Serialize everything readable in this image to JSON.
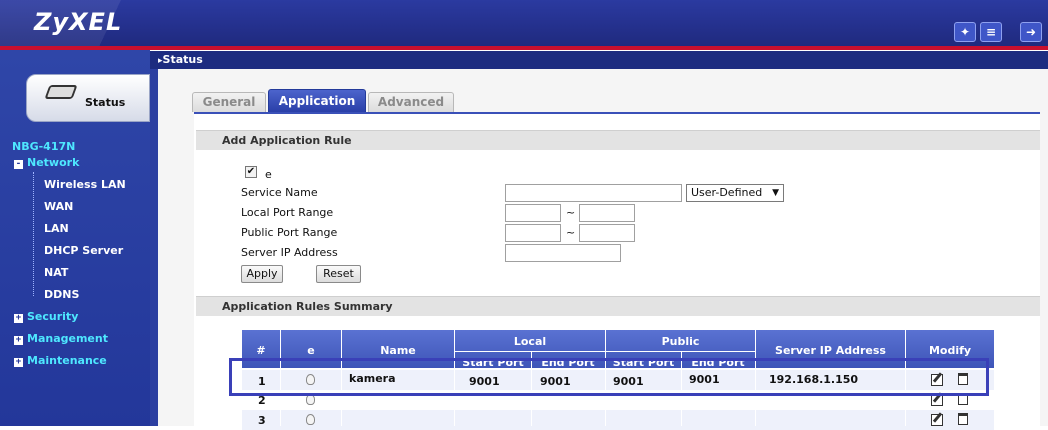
{
  "header": {
    "brand": "ZyXEL"
  },
  "page_title": "Status",
  "status_tab_label": "Status",
  "nav": {
    "device": "NBG-417N",
    "items": [
      {
        "label": "Network",
        "level": "top",
        "expander": "-"
      },
      {
        "label": "Wireless LAN",
        "level": "sub"
      },
      {
        "label": "WAN",
        "level": "sub"
      },
      {
        "label": "LAN",
        "level": "sub"
      },
      {
        "label": "DHCP Server",
        "level": "sub"
      },
      {
        "label": "NAT",
        "level": "sub"
      },
      {
        "label": "DDNS",
        "level": "sub"
      },
      {
        "label": "Security",
        "level": "top",
        "expander": "+"
      },
      {
        "label": "Management",
        "level": "top",
        "expander": "+"
      },
      {
        "label": "Maintenance",
        "level": "top",
        "expander": "+"
      }
    ]
  },
  "tabs": [
    {
      "label": "General",
      "active": false
    },
    {
      "label": "Application",
      "active": true
    },
    {
      "label": "Advanced",
      "active": false
    }
  ],
  "add_rule": {
    "section_title": "Add Application Rule",
    "enable_label": "e",
    "enable_checked": true,
    "service_name_label": "Service Name",
    "service_name_value": "",
    "service_type": "User-Defined",
    "local_port_label": "Local Port Range",
    "public_port_label": "Public Port Range",
    "range_sep": "~",
    "server_ip_label": "Server IP Address",
    "apply_label": "Apply",
    "reset_label": "Reset"
  },
  "summary": {
    "section_title": "Application Rules Summary",
    "headers": {
      "num": "#",
      "enable": "e",
      "name": "Name",
      "local": "Local",
      "public": "Public",
      "start_port": "Start Port",
      "end_port": "End Port",
      "server_ip": "Server IP Address",
      "modify": "Modify"
    },
    "rows": [
      {
        "num": "1",
        "name": "kamera",
        "local_start": "9001",
        "local_end": "9001",
        "public_start": "9001",
        "public_end": "9001",
        "server_ip": "192.168.1.150"
      },
      {
        "num": "2",
        "name": "",
        "local_start": "",
        "local_end": "",
        "public_start": "",
        "public_end": "",
        "server_ip": ""
      },
      {
        "num": "3",
        "name": "",
        "local_start": "",
        "local_end": "",
        "public_start": "",
        "public_end": "",
        "server_ip": ""
      }
    ]
  },
  "colors": {
    "header_blue": "#24308c",
    "accent_red": "#c8102e",
    "nav_cyan": "#4ee8ff",
    "highlight": "#3a40b8"
  }
}
